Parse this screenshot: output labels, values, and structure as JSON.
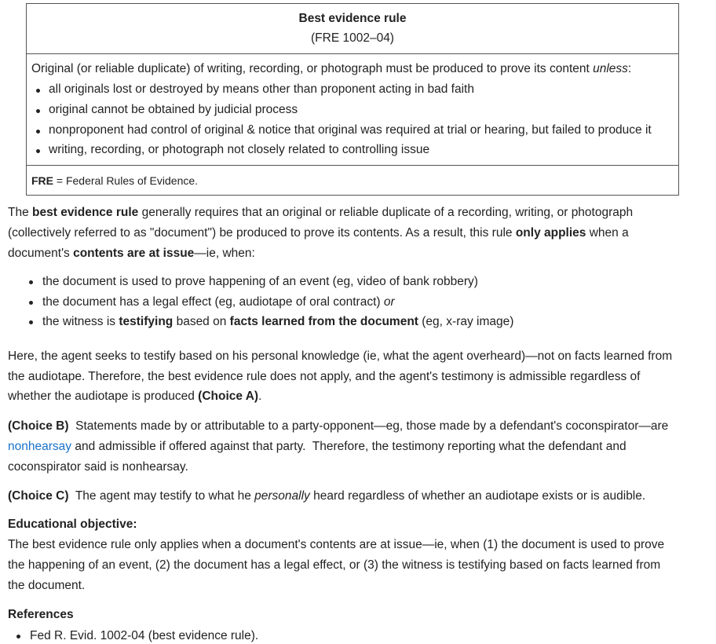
{
  "table": {
    "title": "Best evidence rule",
    "subtitle": "(FRE 1002–04)",
    "lead_main": "Original (or reliable duplicate) of writing, recording, or photograph must be produced to prove its content ",
    "lead_unless": "unless",
    "lead_colon": ":",
    "items": [
      "all originals lost or destroyed by means other than proponent acting in bad faith",
      "original cannot be obtained by judicial process",
      "nonproponent had control of original & notice that original was required at trial or hearing, but failed to produce it",
      "writing, recording, or photograph not closely related to controlling issue"
    ],
    "footnote_abbr": "FRE",
    "footnote_text": " = Federal Rules of Evidence."
  },
  "para1": {
    "l1a": "The ",
    "l1b": "best evidence rule",
    "l1c": " generally requires that an original or reliable duplicate of a recording, writing, or photograph",
    "l2a": "(collectively referred to as \"document\") be produced to prove its contents.  As a result, this rule ",
    "l2b": "only applies",
    "l2c": " when a",
    "l3a": "document's ",
    "l3b": "contents are at issue",
    "l3c": "—ie, when:"
  },
  "bullets": {
    "b1": "the document is used to prove happening of an event (eg, video of bank robbery)",
    "b2a": "the document has a legal effect (eg, audiotape of oral contract) ",
    "b2b": "or",
    "b3a": "the witness is ",
    "b3b": "testifying",
    "b3c": " based on ",
    "b3d": "facts learned from the document",
    "b3e": " (eg, x-ray image)"
  },
  "para2": {
    "l1": "Here, the agent seeks to testify based on his personal knowledge (ie, what the agent overheard)—not on facts learned from",
    "l2": "the audiotape.  Therefore, the best evidence rule does not apply, and the agent's testimony is admissible regardless of",
    "l3a": "whether the audiotape is produced ",
    "l3b": "(Choice A)",
    "l3c": "."
  },
  "choiceB": {
    "label": "(Choice B)",
    "l1": "  Statements made by or attributable to a party-opponent—eg, those made by a defendant's coconspirator—are",
    "link": "nonhearsay",
    "l2": " and admissible if offered against that party.  Therefore, the testimony reporting what the defendant and",
    "l3": "coconspirator said is nonhearsay."
  },
  "choiceC": {
    "label": "(Choice C)",
    "a": "  The agent may testify to what he ",
    "b": "personally",
    "c": " heard regardless of whether an audiotape exists or is audible."
  },
  "objective": {
    "heading": "Educational objective:",
    "l1": "The best evidence rule only applies when a document's contents are at issue—ie, when (1) the document is used to prove",
    "l2": "the happening of an event, (2) the document has a legal effect, or (3) the witness is testifying based on facts learned from",
    "l3": "the document."
  },
  "references": {
    "heading": "References",
    "item": "Fed R. Evid. 1002-04 (best evidence rule)."
  },
  "colors": {
    "text": "#222222",
    "link": "#1a73c8",
    "border": "#555555"
  }
}
